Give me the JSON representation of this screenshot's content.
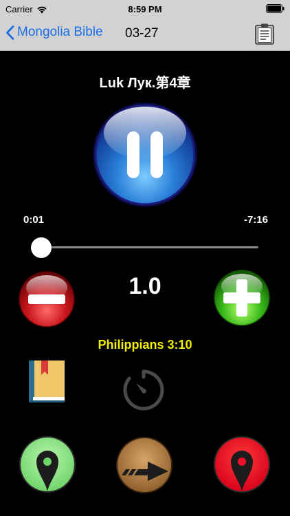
{
  "status_bar": {
    "carrier": "Carrier",
    "time": "8:59 PM"
  },
  "nav_bar": {
    "back_label": "Mongolia Bible",
    "title": "03-27"
  },
  "player": {
    "chapter_title": "Luk Лук.第4章",
    "elapsed": "0:01",
    "remaining": "-7:16",
    "progress": 0.002,
    "speed": "1.0",
    "verse_ref": "Philippians 3:10"
  },
  "colors": {
    "nav_bg": "#d2d2d2",
    "link_blue": "#1a6fe8",
    "verse_yellow": "#f5f000",
    "background": "#000000"
  }
}
